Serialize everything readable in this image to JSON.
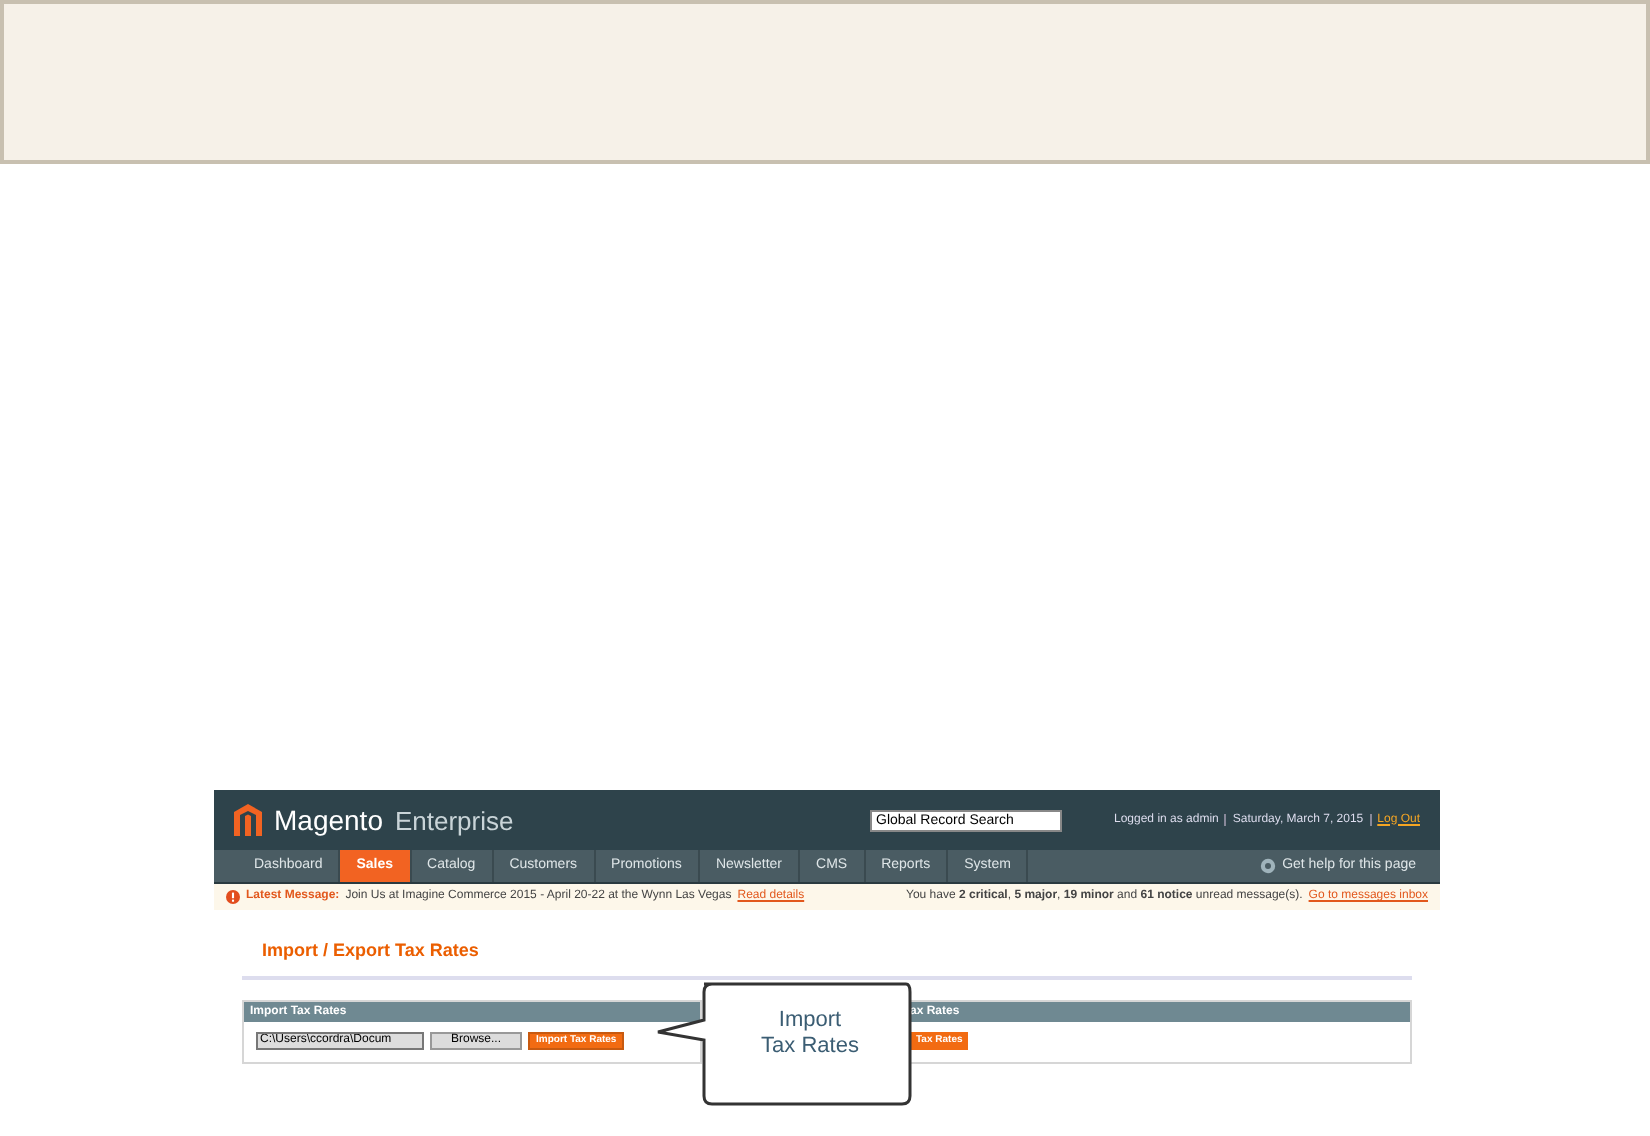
{
  "screenshot": {
    "logo": {
      "brand": "Magento",
      "product": "Enterprise"
    },
    "search": {
      "value": "Global Record Search"
    },
    "user_info": "Logged in as admin",
    "date": "Saturday, March 7, 2015",
    "logout": "Log Out",
    "nav": [
      {
        "label": "Dashboard",
        "selected": false
      },
      {
        "label": "Sales",
        "selected": true
      },
      {
        "label": "Catalog",
        "selected": false
      },
      {
        "label": "Customers",
        "selected": false
      },
      {
        "label": "Promotions",
        "selected": false
      },
      {
        "label": "Newsletter",
        "selected": false
      },
      {
        "label": "CMS",
        "selected": false
      },
      {
        "label": "Reports",
        "selected": false
      },
      {
        "label": "System",
        "selected": false
      }
    ],
    "help_link": "Get help for this page",
    "message": {
      "label": "Latest Message:",
      "text": "Join Us at Imagine Commerce 2015 - April 20-22 at the Wynn Las Vegas",
      "link": "Read details"
    },
    "inbox": {
      "text": "You have **2 critical**, **5 major**, **19 minor** and **61 notice** unread message(s).",
      "link": "Go to messages inbox"
    },
    "page_title": "Import / Export Tax Rates",
    "import_section": {
      "title": "Import Tax Rates",
      "file_value": "C:\\Users\\ccordra\\Docum",
      "browse": "Browse...",
      "button": "Import Tax Rates"
    },
    "export_section": {
      "title": "ax Rates",
      "button": "Tax Rates"
    },
    "callout": [
      "Import",
      "Tax Rates"
    ]
  }
}
